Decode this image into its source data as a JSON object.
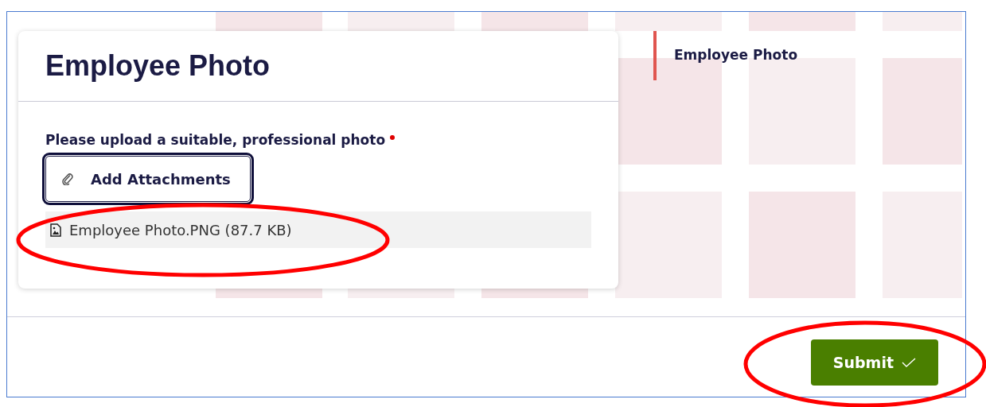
{
  "card": {
    "title": "Employee Photo",
    "field": {
      "label": "Please upload a suitable, professional photo",
      "required": true
    },
    "attach_button": {
      "label": "Add Attachments",
      "focused": true
    },
    "files": [
      {
        "name": "Employee Photo.PNG (87.7 KB)"
      }
    ]
  },
  "nav": {
    "items": [
      {
        "label": "Employee Photo",
        "selected": true
      }
    ]
  },
  "submit_button": {
    "label": "Submit"
  }
}
